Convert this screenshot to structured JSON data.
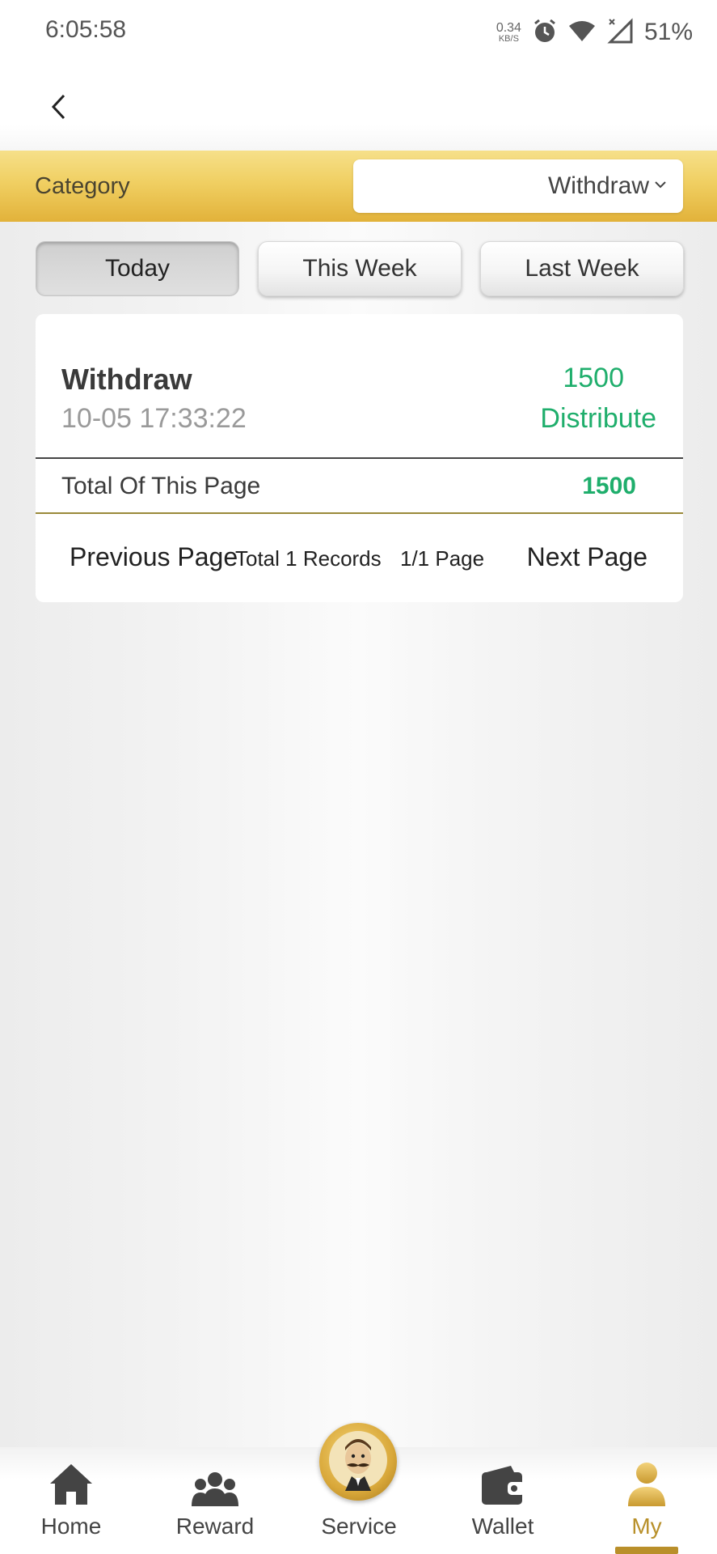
{
  "status_bar": {
    "time": "6:05:58",
    "net_speed_value": "0.34",
    "net_speed_unit": "KB/S",
    "battery": "51%"
  },
  "category": {
    "label": "Category",
    "selected": "Withdraw"
  },
  "tabs": [
    {
      "label": "Today",
      "active": true
    },
    {
      "label": "This Week",
      "active": false
    },
    {
      "label": "Last Week",
      "active": false
    }
  ],
  "record": {
    "title": "Withdraw",
    "time": "10-05 17:33:22",
    "amount": "1500",
    "status": "Distribute"
  },
  "summary": {
    "total_label": "Total Of This Page",
    "total_value": "1500"
  },
  "pager": {
    "prev": "Previous Page",
    "total_records": "Total 1 Records",
    "page_indicator": "1/1 Page",
    "next": "Next Page"
  },
  "bottom_nav": {
    "items": [
      {
        "label": "Home",
        "icon": "home-icon"
      },
      {
        "label": "Reward",
        "icon": "group-icon"
      },
      {
        "label": "Service",
        "icon": "service-avatar-icon"
      },
      {
        "label": "Wallet",
        "icon": "wallet-icon"
      },
      {
        "label": "My",
        "icon": "user-icon",
        "active": true
      }
    ]
  },
  "colors": {
    "accent_gold": "#e2b23a",
    "positive_green": "#1fae6c",
    "active_nav": "#b8902a"
  }
}
